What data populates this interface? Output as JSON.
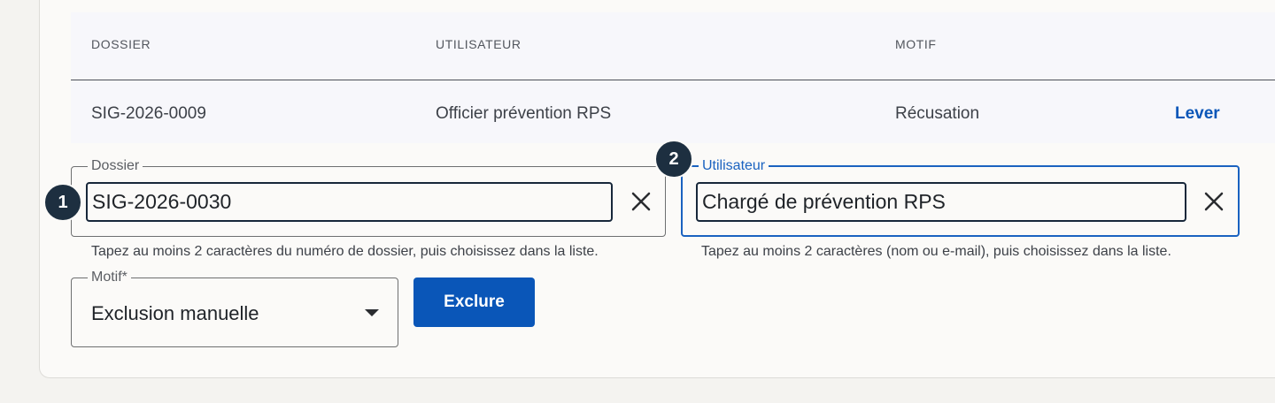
{
  "table": {
    "headers": [
      "DOSSIER",
      "UTILISATEUR",
      "MOTIF"
    ],
    "rows": [
      {
        "dossier": "SIG-2026-0009",
        "utilisateur": "Officier prévention RPS",
        "motif": "Récusation",
        "action": "Lever"
      }
    ]
  },
  "form": {
    "dossier": {
      "legend": "Dossier",
      "value": "SIG-2026-0030",
      "helper": "Tapez au moins 2 caractères du numéro de dossier, puis choisissez dans la liste.",
      "badge": "1"
    },
    "utilisateur": {
      "legend": "Utilisateur",
      "value": "Chargé de prévention RPS",
      "helper": "Tapez au moins 2 caractères (nom ou e-mail), puis choisissez dans la liste.",
      "badge": "2"
    },
    "motif": {
      "legend": "Motif*",
      "value": "Exclusion manuelle"
    },
    "submit_label": "Exclure"
  },
  "colors": {
    "accent": "#0a56b8",
    "focus": "#1a62c0",
    "badge": "#1d2f40"
  }
}
